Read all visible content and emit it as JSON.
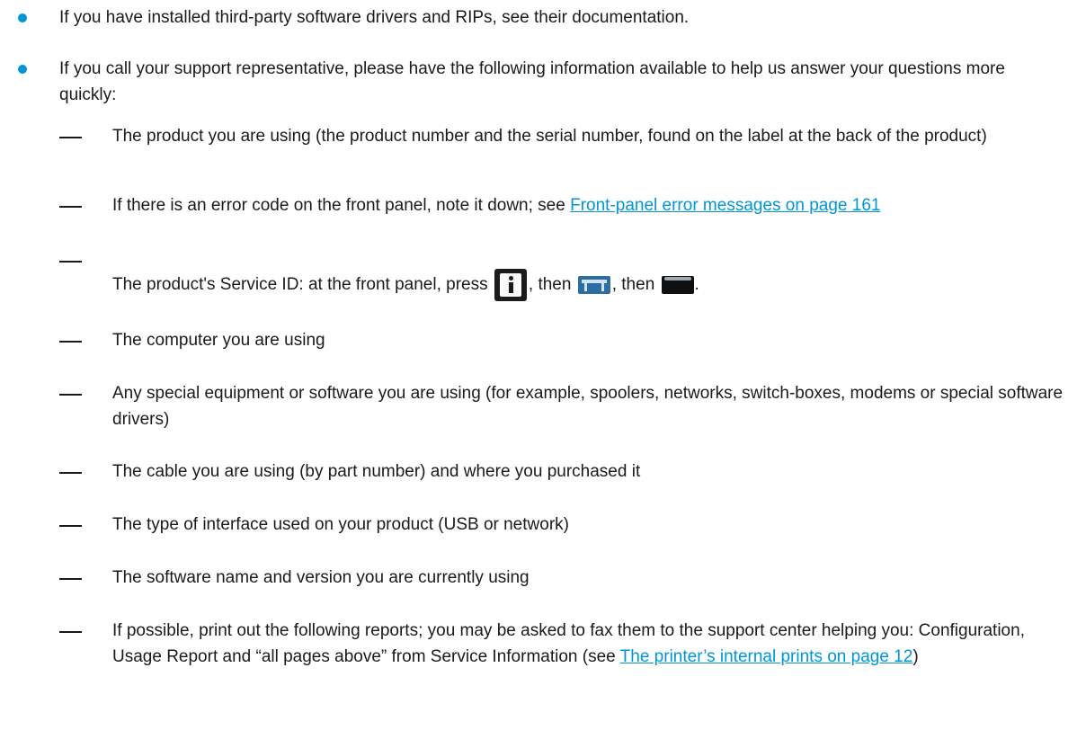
{
  "colors": {
    "bullet": "#0096d6",
    "link": "#0096d6",
    "text": "#1a1a1a"
  },
  "bullets": [
    {
      "text": "If you have installed third-party software drivers and RIPs, see their documentation."
    },
    {
      "text": "If you call your support representative, please have the following information available to help us answer your questions more quickly:"
    }
  ],
  "sub_items": {
    "product": "The product you are using (the product number and the serial number, found on the label at the back of the product)",
    "error_code": {
      "text": "If there is an error code on the front panel, note it down; see ",
      "link": "Front-panel error messages on page 161"
    },
    "service_id": {
      "text_before": "The product's Service ID: at the front panel, press ",
      "then1": ", then ",
      "then2": ", then ",
      "end": ".",
      "icons": [
        "info-icon",
        "printer-icon",
        "printer-device-icon"
      ]
    },
    "computer": "The computer you are using",
    "equipment": "Any special equipment or software you are using (for example, spoolers, networks, switch-boxes, modems or special software drivers)",
    "cable": "The cable you are using (by part number) and where you purchased it",
    "interface": "The type of interface used on your product (USB or network)",
    "software": "The software name and version you are currently using",
    "reports": {
      "text": "If possible, print out the following reports; you may be asked to fax them to the support center helping you: Configuration, Usage Report and “all pages above” from Service Information (see ",
      "link": "The printer’s internal prints on page 12",
      "end": ")"
    }
  }
}
